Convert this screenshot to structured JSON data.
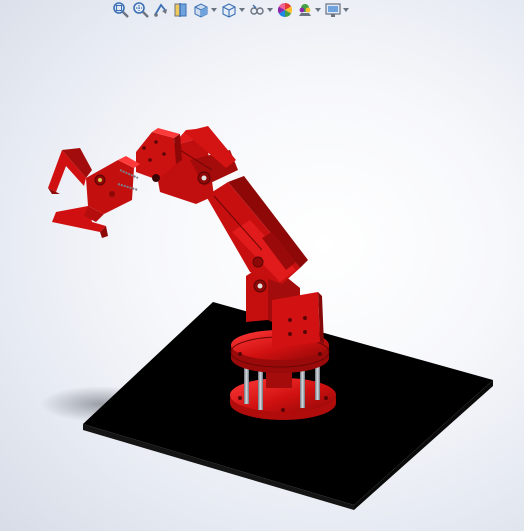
{
  "view_toolbar": {
    "items": [
      {
        "name": "zoom-to-fit-icon",
        "dropdown": false
      },
      {
        "name": "zoom-to-area-icon",
        "dropdown": false
      },
      {
        "name": "previous-view-icon",
        "dropdown": false
      },
      {
        "name": "section-view-icon",
        "dropdown": false
      },
      {
        "name": "view-orientation-icon",
        "dropdown": true
      },
      {
        "name": "display-style-icon",
        "dropdown": true
      },
      {
        "name": "hide-show-items-icon",
        "dropdown": true
      },
      {
        "name": "edit-appearance-icon",
        "dropdown": false
      },
      {
        "name": "apply-scene-icon",
        "dropdown": true
      },
      {
        "name": "view-settings-icon",
        "dropdown": true
      }
    ]
  },
  "model": {
    "part_color": "#d01010",
    "part_dark": "#8e0808",
    "part_light": "#ff3a3a",
    "base_plate_color": "#000000",
    "rod_color": "#9aa0a8"
  },
  "colors": {
    "background_center": "#ffffff",
    "background_edge": "#d7dce7",
    "icon_blue": "#3a6fb4",
    "icon_gray": "#6b7380"
  }
}
